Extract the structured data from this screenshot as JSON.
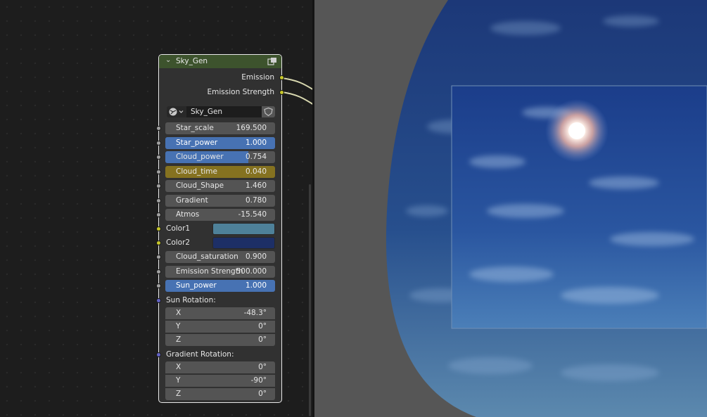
{
  "node": {
    "title": "Sky_Gen",
    "header_color": "#3d532d",
    "outputs": [
      {
        "label": "Emission"
      },
      {
        "label": "Emission Strength"
      }
    ],
    "group": {
      "name": "Sky_Gen"
    },
    "fields": [
      {
        "label": "Star_scale",
        "value": "169.500",
        "fill": 0,
        "socket": "grey"
      },
      {
        "label": "Star_power",
        "value": "1.000",
        "fill": 1.0,
        "socket": "grey"
      },
      {
        "label": "Cloud_power",
        "value": "0.754",
        "fill": 0.754,
        "socket": "grey"
      },
      {
        "label": "Cloud_time",
        "value": "0.040",
        "fill": 0,
        "keyframed": true,
        "socket": "grey"
      },
      {
        "label": "Cloud_Shape",
        "value": "1.460",
        "fill": 0,
        "socket": "grey"
      },
      {
        "label": "Gradient",
        "value": "0.780",
        "fill": 0,
        "socket": "grey"
      },
      {
        "label": "Atmos",
        "value": "-15.540",
        "fill": 0,
        "socket": "grey"
      }
    ],
    "colors": [
      {
        "label": "Color1",
        "swatch": "#4e8199"
      },
      {
        "label": "Color2",
        "swatch": "#1d2f66"
      }
    ],
    "fields2": [
      {
        "label": "Cloud_saturation",
        "value": "0.900",
        "fill": 0,
        "socket": "grey"
      },
      {
        "label": "Emission Strength",
        "value": "500.000",
        "fill": 0,
        "socket": "grey"
      },
      {
        "label": "Sun_power",
        "value": "1.000",
        "fill": 1.0,
        "socket": "grey"
      }
    ],
    "sun_rotation": {
      "label": "Sun Rotation:",
      "rows": [
        {
          "axis": "X",
          "value": "-48.3°"
        },
        {
          "axis": "Y",
          "value": "0°"
        },
        {
          "axis": "Z",
          "value": "0°"
        }
      ]
    },
    "gradient_rotation": {
      "label": "Gradient Rotation:",
      "rows": [
        {
          "axis": "X",
          "value": "0°"
        },
        {
          "axis": "Y",
          "value": "-90°"
        },
        {
          "axis": "Z",
          "value": "0°"
        }
      ]
    }
  },
  "colors": {
    "socket_grey": "#a1a1a1",
    "socket_yellow": "#c7c729",
    "socket_blue": "#6363c7",
    "field_selected": "#4772b3",
    "field_keyframed": "#857220",
    "sky_top": "#1e3a7a",
    "sky_bottom": "#5b88ad"
  }
}
